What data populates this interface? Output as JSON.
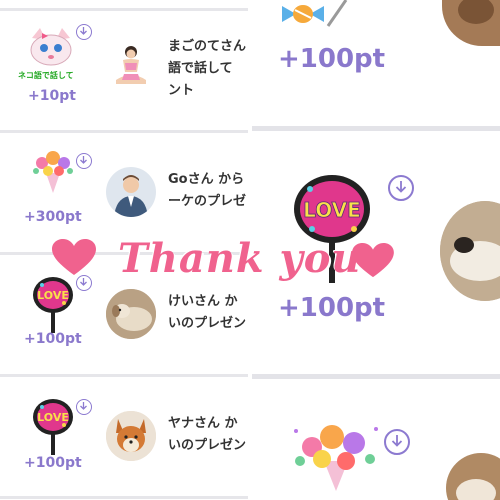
{
  "left_items": [
    {
      "points": "+10pt",
      "message_line1": "まごのてさん",
      "message_line2": "語で話して",
      "message_line3": "ント",
      "gift": "neko-sticker",
      "gift_caption": "ネコ語で話して",
      "avatar": "meditating-figure"
    },
    {
      "points": "+300pt",
      "message_line1": "Goさん から",
      "message_line2": "ーケのプレゼ",
      "gift": "bouquet",
      "avatar": "man-in-suit"
    },
    {
      "points": "+100pt",
      "message_line1": "けいさん か",
      "message_line2": "いのプレゼン",
      "gift": "love-uchiwa",
      "gift_label": "LOVE",
      "avatar": "dog-photo"
    },
    {
      "points": "+100pt",
      "message_line1": "ヤナさん か",
      "message_line2": "いのプレゼン",
      "gift": "love-uchiwa",
      "gift_label": "LOVE",
      "avatar": "shiba-dog-photo"
    }
  ],
  "right_items": [
    {
      "points": "+100pt",
      "gift": "candy"
    },
    {
      "points": "+100pt",
      "gift": "love-uchiwa",
      "gift_label": "LOVE"
    },
    {
      "gift": "bouquet"
    }
  ],
  "overlay": {
    "text": "Thank you",
    "heart_color": "#f0628e"
  },
  "colors": {
    "accent": "#8a78cc",
    "separator": "#e6e6ea"
  }
}
